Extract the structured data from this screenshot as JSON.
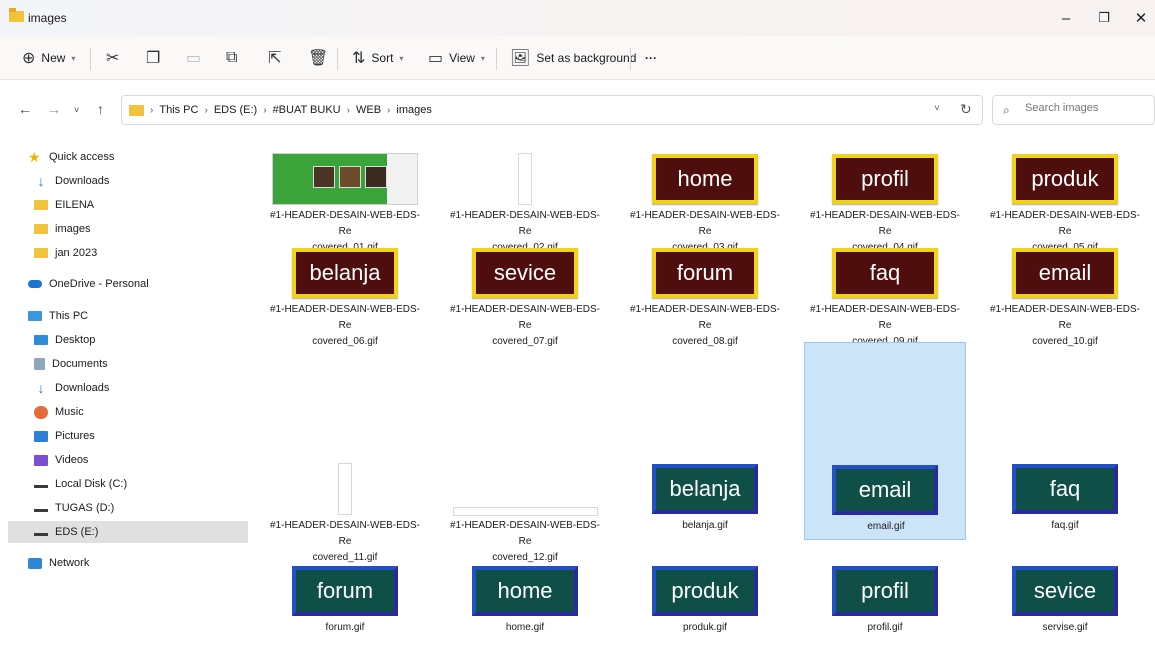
{
  "window": {
    "title": "images",
    "minimize_glyph": "–",
    "maximize_glyph": "❐",
    "close_glyph": "✕"
  },
  "commandbar": {
    "new_label": "New",
    "sort_label": "Sort",
    "view_label": "View",
    "set_bg_label": "Set as background",
    "more_label": "···"
  },
  "address": {
    "crumbs": [
      "This PC",
      "EDS (E:)",
      "#BUAT BUKU",
      "WEB",
      "images"
    ],
    "search_placeholder": "Search images"
  },
  "sidebar": {
    "items": [
      {
        "label": "Quick access",
        "icon": "star-icon"
      },
      {
        "label": "Downloads",
        "icon": "download-icon"
      },
      {
        "label": "EILENA",
        "icon": "folder-icon"
      },
      {
        "label": "images",
        "icon": "folder-icon"
      },
      {
        "label": "jan 2023",
        "icon": "folder-icon"
      },
      {
        "label": "OneDrive - Personal",
        "icon": "cloud-icon"
      },
      {
        "label": "This PC",
        "icon": "pc-icon"
      },
      {
        "label": "Desktop",
        "icon": "desktop-icon"
      },
      {
        "label": "Documents",
        "icon": "documents-icon"
      },
      {
        "label": "Downloads",
        "icon": "download-icon"
      },
      {
        "label": "Music",
        "icon": "music-icon"
      },
      {
        "label": "Pictures",
        "icon": "pictures-icon"
      },
      {
        "label": "Videos",
        "icon": "videos-icon"
      },
      {
        "label": "Local Disk (C:)",
        "icon": "disk-icon"
      },
      {
        "label": "TUGAS (D:)",
        "icon": "drive-icon"
      },
      {
        "label": "EDS (E:)",
        "icon": "drive-icon"
      },
      {
        "label": "Network",
        "icon": "network-icon"
      }
    ]
  },
  "files": [
    {
      "name1": "#1-HEADER-DESAIN-WEB-EDS-Re",
      "name2": "covered_01.gif",
      "thumb": "header"
    },
    {
      "name1": "#1-HEADER-DESAIN-WEB-EDS-Re",
      "name2": "covered_02.gif",
      "thumb": "blank-tall"
    },
    {
      "name1": "#1-HEADER-DESAIN-WEB-EDS-Re",
      "name2": "covered_03.gif",
      "thumb": "red",
      "text": "home"
    },
    {
      "name1": "#1-HEADER-DESAIN-WEB-EDS-Re",
      "name2": "covered_04.gif",
      "thumb": "red",
      "text": "profil"
    },
    {
      "name1": "#1-HEADER-DESAIN-WEB-EDS-Re",
      "name2": "covered_05.gif",
      "thumb": "red",
      "text": "produk"
    },
    {
      "name1": "#1-HEADER-DESAIN-WEB-EDS-Re",
      "name2": "covered_06.gif",
      "thumb": "red",
      "text": "belanja"
    },
    {
      "name1": "#1-HEADER-DESAIN-WEB-EDS-Re",
      "name2": "covered_07.gif",
      "thumb": "red",
      "text": "sevice"
    },
    {
      "name1": "#1-HEADER-DESAIN-WEB-EDS-Re",
      "name2": "covered_08.gif",
      "thumb": "red",
      "text": "forum"
    },
    {
      "name1": "#1-HEADER-DESAIN-WEB-EDS-Re",
      "name2": "covered_09.gif",
      "thumb": "red",
      "text": "faq"
    },
    {
      "name1": "#1-HEADER-DESAIN-WEB-EDS-Re",
      "name2": "covered_10.gif",
      "thumb": "red",
      "text": "email"
    },
    {
      "name1": "#1-HEADER-DESAIN-WEB-EDS-Re",
      "name2": "covered_11.gif",
      "thumb": "blank-tall"
    },
    {
      "name1": "#1-HEADER-DESAIN-WEB-EDS-Re",
      "name2": "covered_12.gif",
      "thumb": "blank-wide"
    },
    {
      "name1": "belanja.gif",
      "name2": "",
      "thumb": "teal",
      "text": "belanja"
    },
    {
      "name1": "email.gif",
      "name2": "",
      "thumb": "teal",
      "text": "email",
      "selected": true
    },
    {
      "name1": "faq.gif",
      "name2": "",
      "thumb": "teal",
      "text": "faq"
    },
    {
      "name1": "forum.gif",
      "name2": "",
      "thumb": "teal",
      "text": "forum"
    },
    {
      "name1": "home.gif",
      "name2": "",
      "thumb": "teal",
      "text": "home"
    },
    {
      "name1": "produk.gif",
      "name2": "",
      "thumb": "teal",
      "text": "produk"
    },
    {
      "name1": "profil.gif",
      "name2": "",
      "thumb": "teal",
      "text": "profil"
    },
    {
      "name1": "servise.gif",
      "name2": "",
      "thumb": "teal",
      "text": "sevice"
    }
  ],
  "colors": {
    "selection": "#cce4f7",
    "red_button": "#4f0e0e",
    "red_border": "#f0d21a",
    "teal_button": "#0f4f47",
    "teal_border": "#2350c8"
  }
}
